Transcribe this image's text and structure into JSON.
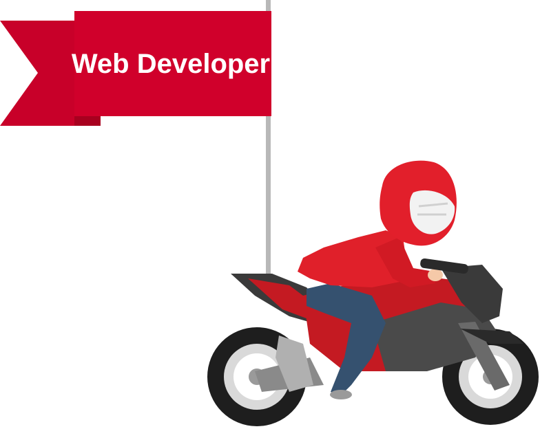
{
  "flag": {
    "label": "Web Developer",
    "color": "#d0002b",
    "shadow_color": "#b80025"
  },
  "colors": {
    "pole": "#b8b8b8",
    "jacket": "#e0202a",
    "helmet": "#e21f2b",
    "visor": "#f2f2f2",
    "jeans": "#35516f",
    "bike_red": "#c41a22",
    "bike_dark": "#4a4a4a",
    "tire": "#1e1e1e",
    "rim": "#d9d9d9",
    "skin": "#f5c9a8"
  },
  "icons": {
    "flag": "flag-icon",
    "rider": "motorcycle-rider-illustration"
  }
}
